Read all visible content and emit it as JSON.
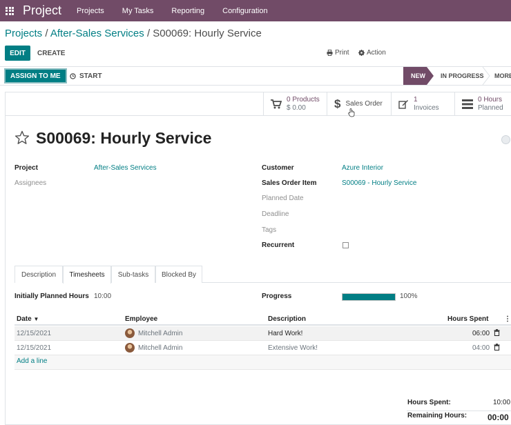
{
  "navbar": {
    "app_name": "Project",
    "menus": [
      "Projects",
      "My Tasks",
      "Reporting",
      "Configuration"
    ]
  },
  "breadcrumb": {
    "items": [
      "Projects",
      "After-Sales Services"
    ],
    "separator": "/",
    "current": "S00069: Hourly Service"
  },
  "control_panel": {
    "edit_label": "EDIT",
    "create_label": "CREATE",
    "print_label": "Print",
    "action_label": "Action"
  },
  "statusbar": {
    "assign_label": "ASSIGN TO ME",
    "start_label": "START",
    "stages": [
      "NEW",
      "IN PROGRESS",
      "MORE"
    ],
    "active_stage": "NEW"
  },
  "smart_buttons": {
    "products": {
      "value": "0 Products",
      "sub": "$ 0.00"
    },
    "sales_order": {
      "label": "Sales Order"
    },
    "invoices": {
      "value": "1",
      "sub": "Invoices"
    },
    "hours": {
      "value": "0  Hours",
      "sub": "Planned"
    }
  },
  "task": {
    "title": "S00069: Hourly Service"
  },
  "fields": {
    "project_label": "Project",
    "project_value": "After-Sales Services",
    "assignees_label": "Assignees",
    "customer_label": "Customer",
    "customer_value": "Azure Interior",
    "sales_order_item_label": "Sales Order Item",
    "sales_order_item_value": "S00069 - Hourly Service",
    "planned_date_label": "Planned Date",
    "deadline_label": "Deadline",
    "tags_label": "Tags",
    "recurrent_label": "Recurrent",
    "recurrent_checked": false
  },
  "tabs": {
    "items": [
      "Description",
      "Timesheets",
      "Sub-tasks",
      "Blocked By"
    ],
    "active": "Timesheets"
  },
  "timesheet": {
    "initially_planned_label": "Initially Planned Hours",
    "initially_planned_value": "10:00",
    "progress_label": "Progress",
    "progress_value": "100%",
    "progress_fraction": 1.0,
    "columns": {
      "date": "Date",
      "employee": "Employee",
      "description": "Description",
      "hours": "Hours Spent"
    },
    "rows": [
      {
        "date": "12/15/2021",
        "employee": "Mitchell Admin",
        "description": "Hard Work!",
        "hours": "06:00"
      },
      {
        "date": "12/15/2021",
        "employee": "Mitchell Admin",
        "description": "Extensive Work!",
        "hours": "04:00"
      }
    ],
    "add_line_label": "Add a line",
    "hours_spent_label": "Hours Spent:",
    "hours_spent_value": "10:00",
    "remaining_label": "Remaining Hours:",
    "remaining_value": "00:00"
  },
  "colors": {
    "navbar": "#714b67",
    "primary": "#017e84",
    "stage_active": "#714b67"
  }
}
